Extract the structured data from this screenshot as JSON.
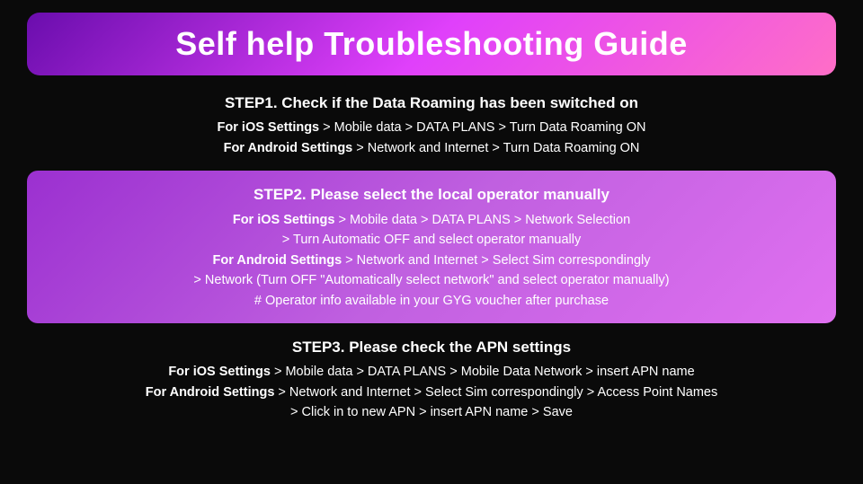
{
  "title": "Self help Troubleshooting Guide",
  "steps": [
    {
      "id": "step1",
      "highlighted": false,
      "title": "STEP1. Check if the Data Roaming has been switched on",
      "lines": [
        {
          "bold": "For iOS Settings",
          "rest": " > Mobile data > DATA PLANS > Turn Data Roaming ON"
        },
        {
          "bold": "For Android Settings",
          "rest": " > Network and Internet > Turn Data Roaming ON"
        }
      ]
    },
    {
      "id": "step2",
      "highlighted": true,
      "title": "STEP2. Please select the local operator manually",
      "lines": [
        {
          "bold": "For iOS Settings",
          "rest": " > Mobile data > DATA PLANS > Network Selection"
        },
        {
          "bold": "",
          "rest": "> Turn Automatic OFF and select operator manually"
        },
        {
          "bold": "For Android Settings",
          "rest": " > Network and Internet > Select Sim correspondingly"
        },
        {
          "bold": "",
          "rest": "> Network (Turn OFF \"Automatically select network\" and select operator manually)"
        },
        {
          "bold": "",
          "rest": "# Operator info available in your GYG voucher after purchase"
        }
      ]
    },
    {
      "id": "step3",
      "highlighted": false,
      "title": "STEP3. Please check the APN settings",
      "lines": [
        {
          "bold": "For iOS Settings",
          "rest": " > Mobile data > DATA PLANS > Mobile Data Network > insert APN name"
        },
        {
          "bold": "For Android Settings",
          "rest": " > Network and Internet > Select Sim correspondingly > Access Point Names"
        },
        {
          "bold": "",
          "rest": "> Click in to new APN > insert APN name > Save"
        }
      ]
    }
  ]
}
